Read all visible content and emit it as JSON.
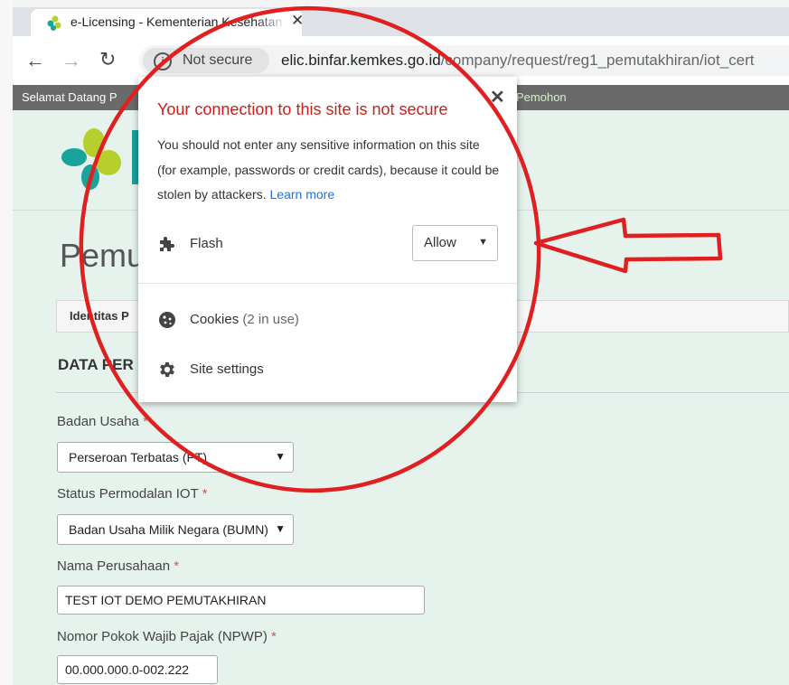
{
  "browser": {
    "tab_title": "e-Licensing - Kementerian Kesehatan",
    "security_chip": "Not secure",
    "url_host": "elic.binfar.kemkes.go.id",
    "url_path": "/company/request/reg1_pemutakhiran/iot_cert"
  },
  "site": {
    "welcome_text": "Selamat Datang P",
    "welcome_right": "Pemohon",
    "heading": "Pemu",
    "tab_label": "Identitas P",
    "section_title": "DATA PER"
  },
  "form": {
    "badan_usaha": {
      "label": "Badan Usaha",
      "required": "*",
      "value": "Perseroan Terbatas (PT)"
    },
    "status_permodalan": {
      "label": "Status Permodalan IOT",
      "required": "*",
      "value": "Badan Usaha Milik Negara (BUMN)"
    },
    "nama_perusahaan": {
      "label": "Nama Perusahaan",
      "required": "*",
      "value": "TEST IOT DEMO PEMUTAKHIRAN"
    },
    "npwp": {
      "label": "Nomor Pokok Wajib Pajak (NPWP)",
      "required": "*",
      "value": "00.000.000.0-002.222"
    }
  },
  "popup": {
    "title": "Your connection to this site is not secure",
    "body": "You should not enter any sensitive information on this site (for example, passwords or credit cards), because it could be stolen by attackers.",
    "learn_more": "Learn more",
    "flash_label": "Flash",
    "flash_value": "Allow",
    "cookies_label": "Cookies",
    "cookies_count": "(2 in use)",
    "site_settings_label": "Site settings"
  },
  "colors": {
    "annotation_red": "#e02020",
    "page_bg": "#e6f3ed",
    "logo_teal": "#1aa39a",
    "logo_green": "#b6cf2c"
  },
  "icons": {
    "puzzle": "puzzle-icon",
    "cookie": "cookie-icon",
    "gear": "gear-icon"
  }
}
